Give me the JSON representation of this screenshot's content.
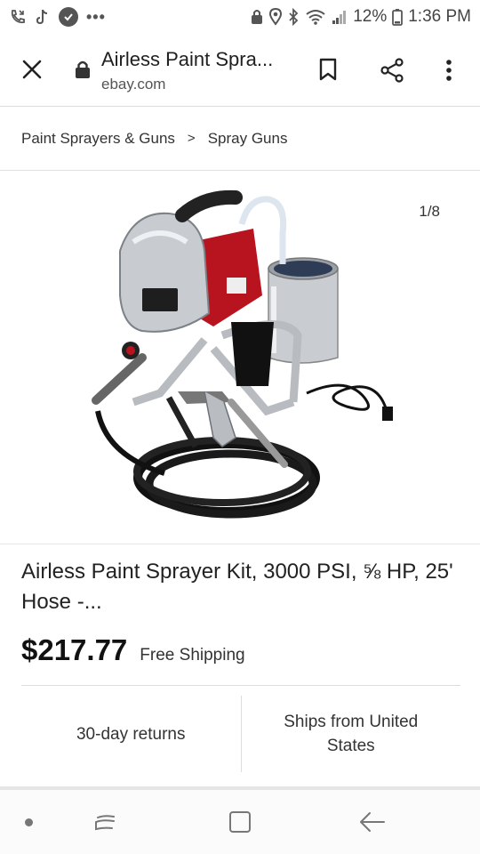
{
  "status_bar": {
    "battery": "12%",
    "time": "1:36 PM",
    "dots": "•••"
  },
  "browser": {
    "page_title": "Airless Paint Spra...",
    "domain": "ebay.com"
  },
  "breadcrumb": {
    "items": [
      "Paint Sprayers & Guns",
      "Spray Guns"
    ],
    "separator": ">"
  },
  "gallery": {
    "counter": "1/8"
  },
  "listing": {
    "title": "Airless Paint Sprayer Kit, 3000 PSI, ⅝ HP, 25' Hose -...",
    "price": "$217.77",
    "shipping": "Free Shipping",
    "returns": "30-day returns",
    "ships_from": "Ships from United States"
  },
  "icons": {
    "close": "close-icon",
    "lock": "lock-icon",
    "bookmark": "bookmark-icon",
    "share": "share-icon",
    "more": "more-vert-icon"
  }
}
